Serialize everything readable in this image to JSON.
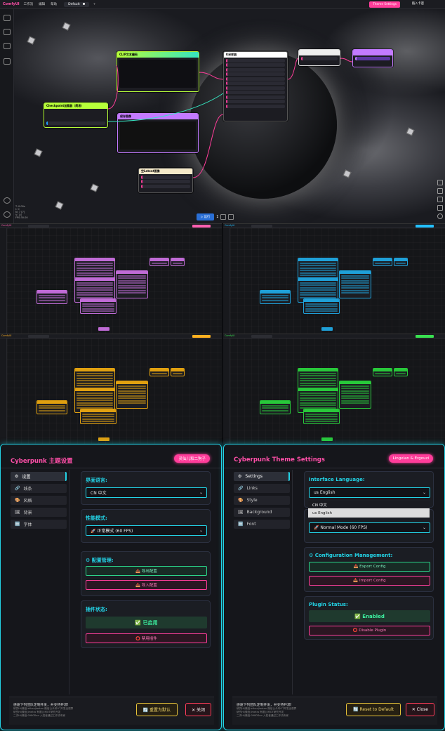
{
  "top": {
    "app_logo": "ComfyUI",
    "menus": [
      "工作流",
      "编辑",
      "帮助"
    ],
    "tab": "Default",
    "theme_button": "Theme Settings",
    "share_button": "插入卡密",
    "run_label": "▷ 运行",
    "queue_count": "1",
    "status_lines": [
      "T: 0.00s",
      "I: 0",
      "N: 7 [7]",
      "V: 14",
      "FPS:30.00"
    ],
    "nodes": [
      {
        "title": "CLIP文本编码",
        "color": "#b7ff3a"
      },
      {
        "title": "K采样器",
        "color": "#ffffff"
      },
      {
        "title": "Checkpoint加载器（简易）",
        "color": "#b7ff3a"
      },
      {
        "title": "保存图像",
        "color": "#c37aff"
      },
      {
        "title": "空Latent图像",
        "color": "#f5e9c8"
      }
    ]
  },
  "quads": [
    {
      "accent": "#ff5fb0",
      "node": "#c06bd6"
    },
    {
      "accent": "#23c0ff",
      "node": "#1fa0d8"
    },
    {
      "accent": "#ffb020",
      "node": "#e0a010"
    },
    {
      "accent": "#39e050",
      "node": "#28c83a"
    }
  ],
  "cn": {
    "title": "Cyberpunk 主题设置",
    "badge": "灵仙儿和二狗子",
    "sidebar": [
      {
        "icon": "⚙",
        "label": "设置"
      },
      {
        "icon": "🔗",
        "label": "线条"
      },
      {
        "icon": "🎨",
        "label": "风格"
      },
      {
        "icon": "🖼",
        "label": "背景"
      },
      {
        "icon": "🔤",
        "label": "字体"
      }
    ],
    "lang_title": "界面语言:",
    "lang_value": "CN 中文",
    "perf_title": "性能模式:",
    "perf_value": "🚀 正常模式 (60 FPS)",
    "config_title": "⚙ 配置管理:",
    "export": "📤 导出配置",
    "import": "📥 导入配置",
    "plugin_title": "插件状态:",
    "enabled": "✅ 已启用",
    "disable": "⭕ 禁用插件",
    "footer_title": "感谢下列团队定制开发，并支持开源!",
    "footer_lines": [
      "研究Hi/微信:ethanjiaotan  微信公众号OT开发出视界",
      "研究Hi/微信:Jmetro  有限公司OT研究开发",
      "二次Hi/微信:0980Dan  入驻者通过工作流专家"
    ],
    "reset": "🔄 重置为默认",
    "close": "✕ 关闭"
  },
  "en": {
    "title": "Cyberpunk Theme Settings",
    "badge": "Lingxian & Ergouzi",
    "sidebar": [
      {
        "icon": "⚙",
        "label": "Settings"
      },
      {
        "icon": "🔗",
        "label": "Links"
      },
      {
        "icon": "🎨",
        "label": "Style"
      },
      {
        "icon": "🖼",
        "label": "Background"
      },
      {
        "icon": "🔤",
        "label": "Font"
      }
    ],
    "lang_title": "Interface Language:",
    "lang_value": "us English",
    "lang_options": [
      "CN 中文",
      "us English"
    ],
    "perf_value": "🚀 Normal Mode (60 FPS)",
    "config_title": "⚙ Configuration Management:",
    "export": "📤 Export Config",
    "import": "📥 Import Config",
    "plugin_title": "Plugin Status:",
    "enabled": "✅ Enabled",
    "disable": "⭕ Disable Plugin",
    "footer_title": "感谢下列团队定制开发，并支持开源!",
    "footer_lines": [
      "研究Hi/微信:ethanjiaotan  微信公众号OT开发出视界",
      "研究Hi/微信:Jmetro  有限公司OT研究开发",
      "二次Hi/微信:0980Dan  入驻者通过工作流专家"
    ],
    "reset": "🔄 Reset to Default",
    "close": "✕ Close"
  }
}
